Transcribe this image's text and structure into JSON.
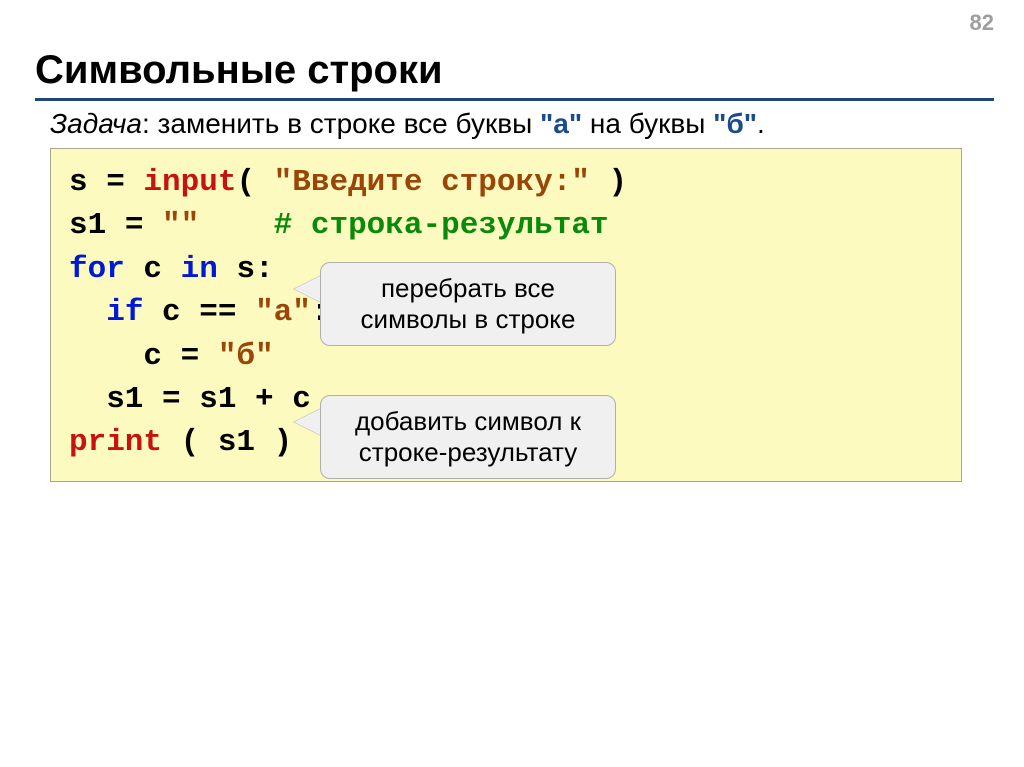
{
  "page_number": "82",
  "title": "Символьные строки",
  "problem": {
    "label": "Задача",
    "text_before": ": заменить в строке все буквы ",
    "quote_a": "\"а\"",
    "text_mid": " на буквы ",
    "quote_b": "\"б\"",
    "text_after": "."
  },
  "code": {
    "l1_s": "s",
    "l1_eq": " = ",
    "l1_input": "input",
    "l1_paren_open": "( ",
    "l1_str": "\"Введите строку:\"",
    "l1_paren_close": " )",
    "l2_s1": "s1",
    "l2_eq": " = ",
    "l2_str": "\"\"",
    "l2_space": "    ",
    "l2_cmt": "# строка-результат",
    "l3_for": "for",
    "l3_sp1": " c ",
    "l3_in": "in",
    "l3_sp2": " s:",
    "l4_indent": "  ",
    "l4_if": "if",
    "l4_sp": " c == ",
    "l4_str": "\"а\"",
    "l4_colon": ":",
    "l5_indent": "    c = ",
    "l5_str": "\"б\"",
    "l6": "  s1 = s1 + c",
    "l7_print": "print",
    "l7_args": " ( s1 )"
  },
  "callout1_line1": "перебрать все",
  "callout1_line2": "символы в строке",
  "callout2_line1": "добавить символ к",
  "callout2_line2": "строке-результату"
}
